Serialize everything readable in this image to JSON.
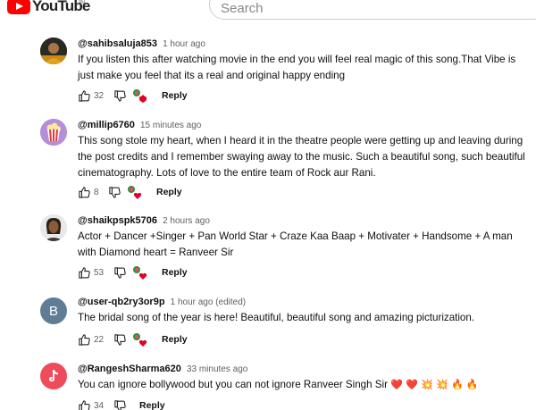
{
  "header": {
    "logo_text": "YouTube",
    "region": "IN",
    "search_placeholder": "Search"
  },
  "comments": [
    {
      "handle": "@sahibsaluja853",
      "time": "1 hour ago",
      "text": "If you listen this after watching movie in the end you will feel real magic of this song.That Vibe is just make you feel that its a real and original happy ending",
      "likes": "32",
      "reply_label": "Reply",
      "avatar": "photo-avatar"
    },
    {
      "handle": "@millip6760",
      "time": "15 minutes ago",
      "text": "This song stole my heart, when I heard it in the theatre people were getting up and leaving during the post credits and I remember swaying away to the music. Such a beautiful song, such beautiful cinematography. Lots of love to the entire team of Rock aur Rani.",
      "likes": "8",
      "reply_label": "Reply",
      "avatar": "popcorn-avatar"
    },
    {
      "handle": "@shaikpspk5706",
      "time": "2 hours ago",
      "text": "Actor + Dancer +Singer + Pan World Star + Craze Kaa Baap + Motivater + Handsome + A man with Diamond heart = Ranveer Sir",
      "likes": "53",
      "reply_label": "Reply",
      "avatar": "photo-avatar"
    },
    {
      "handle": "@user-qb2ry3or9p",
      "time": "1 hour ago (edited)",
      "text": "The bridal song of the year is here! Beautiful, beautiful song and amazing picturization.",
      "likes": "22",
      "reply_label": "Reply",
      "avatar_letter": "B",
      "avatar_color": "#5f7d95"
    },
    {
      "handle": "@RangeshSharma620",
      "time": "33 minutes ago",
      "text": "You can ignore bollywood but you can not ignore Ranveer Singh Sir",
      "emojis": [
        "❤️",
        "❤️",
        "💥",
        "💥",
        "🔥",
        "🔥"
      ],
      "likes": "34",
      "reply_label": "Reply",
      "avatar": "tiktok-avatar",
      "avatar_color": "#f04b5a"
    }
  ],
  "colors": {
    "brand_red": "#ff0000",
    "creator_heart": "#e0002a"
  }
}
